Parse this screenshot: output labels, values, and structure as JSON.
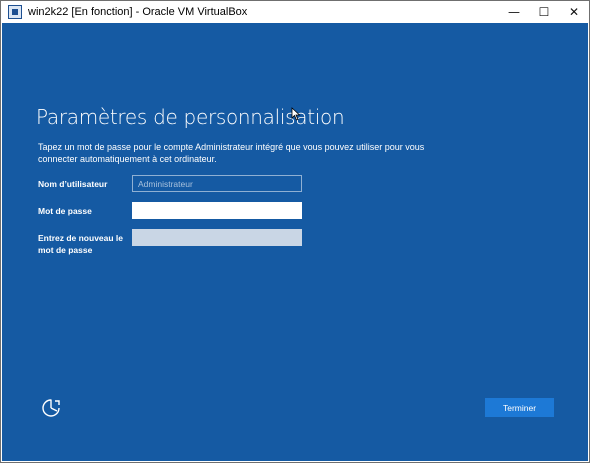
{
  "window": {
    "title": "win2k22 [En fonction] - Oracle VM VirtualBox",
    "minimize_glyph": "—",
    "maximize_glyph": "☐",
    "close_glyph": "✕"
  },
  "setup": {
    "heading": "Paramètres de personnalisation",
    "description": "Tapez un mot de passe pour le compte Administrateur intégré que vous pouvez utiliser pour vous connecter automatiquement à cet ordinateur.",
    "username_label": "Nom d’utilisateur",
    "username_placeholder": "Administrateur",
    "password_label": "Mot de passe",
    "password_value": "",
    "confirm_label": "Entrez de nouveau le mot de passe",
    "confirm_value": "",
    "finish_label": "Terminer"
  },
  "colors": {
    "background": "#155aa3",
    "button": "#1d79d6",
    "text": "#ffffff"
  },
  "icons": {
    "app": "virtualbox-icon",
    "accessibility": "ease-of-access-icon",
    "pointer": "mouse-cursor-icon"
  }
}
